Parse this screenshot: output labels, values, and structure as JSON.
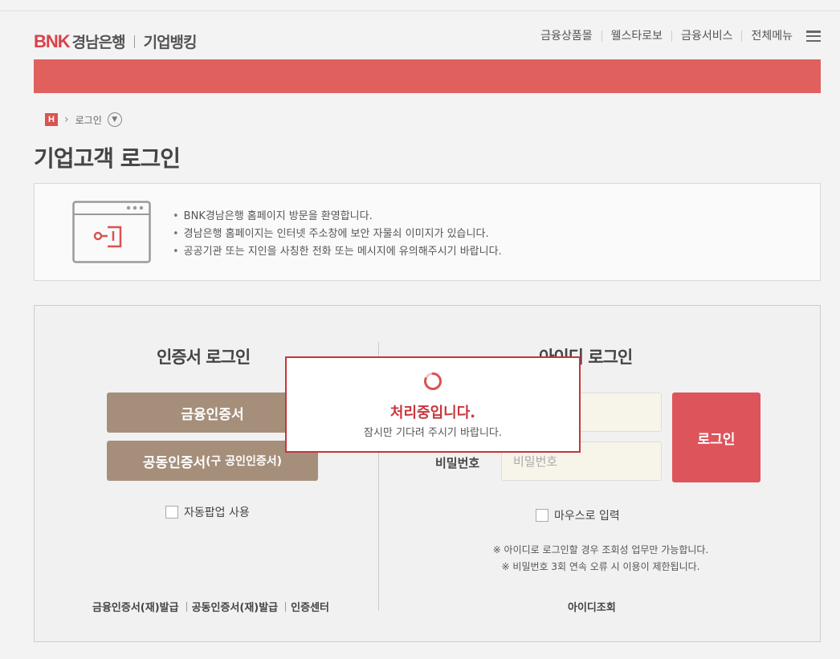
{
  "header": {
    "logo_bnk": "BNK",
    "logo_bank": "경남은행",
    "logo_sub": "기업뱅킹",
    "gnb": [
      "금융상품몰",
      "웰스타로보",
      "금융서비스",
      "전체메뉴"
    ],
    "brand_color": "#d9414a",
    "banner_color": "#e0605e"
  },
  "breadcrumb": {
    "home_label": "H",
    "current": "로그인"
  },
  "page": {
    "title": "기업고객 로그인"
  },
  "notice": {
    "icon": "browser-key-icon",
    "items": [
      "BNK경남은행 홈페이지 방문을 환영합니다.",
      "경남은행 홈페이지는 인터넷 주소창에 보안 자물쇠 이미지가 있습니다.",
      "공공기관 또는 지인을 사칭한 전화 또는 메시지에 유의해주시기 바랍니다."
    ]
  },
  "cert_login": {
    "title": "인증서 로그인",
    "financial_cert": "금융인증서",
    "joint_cert_main": "공동인증서",
    "joint_cert_sub": "(구 공인인증서)",
    "auto_popup": "자동팝업 사용",
    "links": [
      "금융인증서(재)발급",
      "공동인증서(재)발급",
      "인증센터"
    ],
    "button_color": "#a68f7a"
  },
  "id_login": {
    "title": "아이디 로그인",
    "password_label": "비밀번호",
    "password_placeholder": "비밀번호",
    "login_button": "로그인",
    "mouse_input": "마우스로 입력",
    "notes": [
      "※ 아이디로 로그인할 경우 조회성 업무만 가능합니다.",
      "※ 비밀번호 3회 연속 오류 시 이용이 제한됩니다."
    ],
    "id_lookup": "아이디조회",
    "button_color": "#de545b"
  },
  "modal": {
    "title": "처리중입니다.",
    "subtitle": "잠시만 기다려 주시기 바랍니다.",
    "accent_color": "#c8363d"
  }
}
